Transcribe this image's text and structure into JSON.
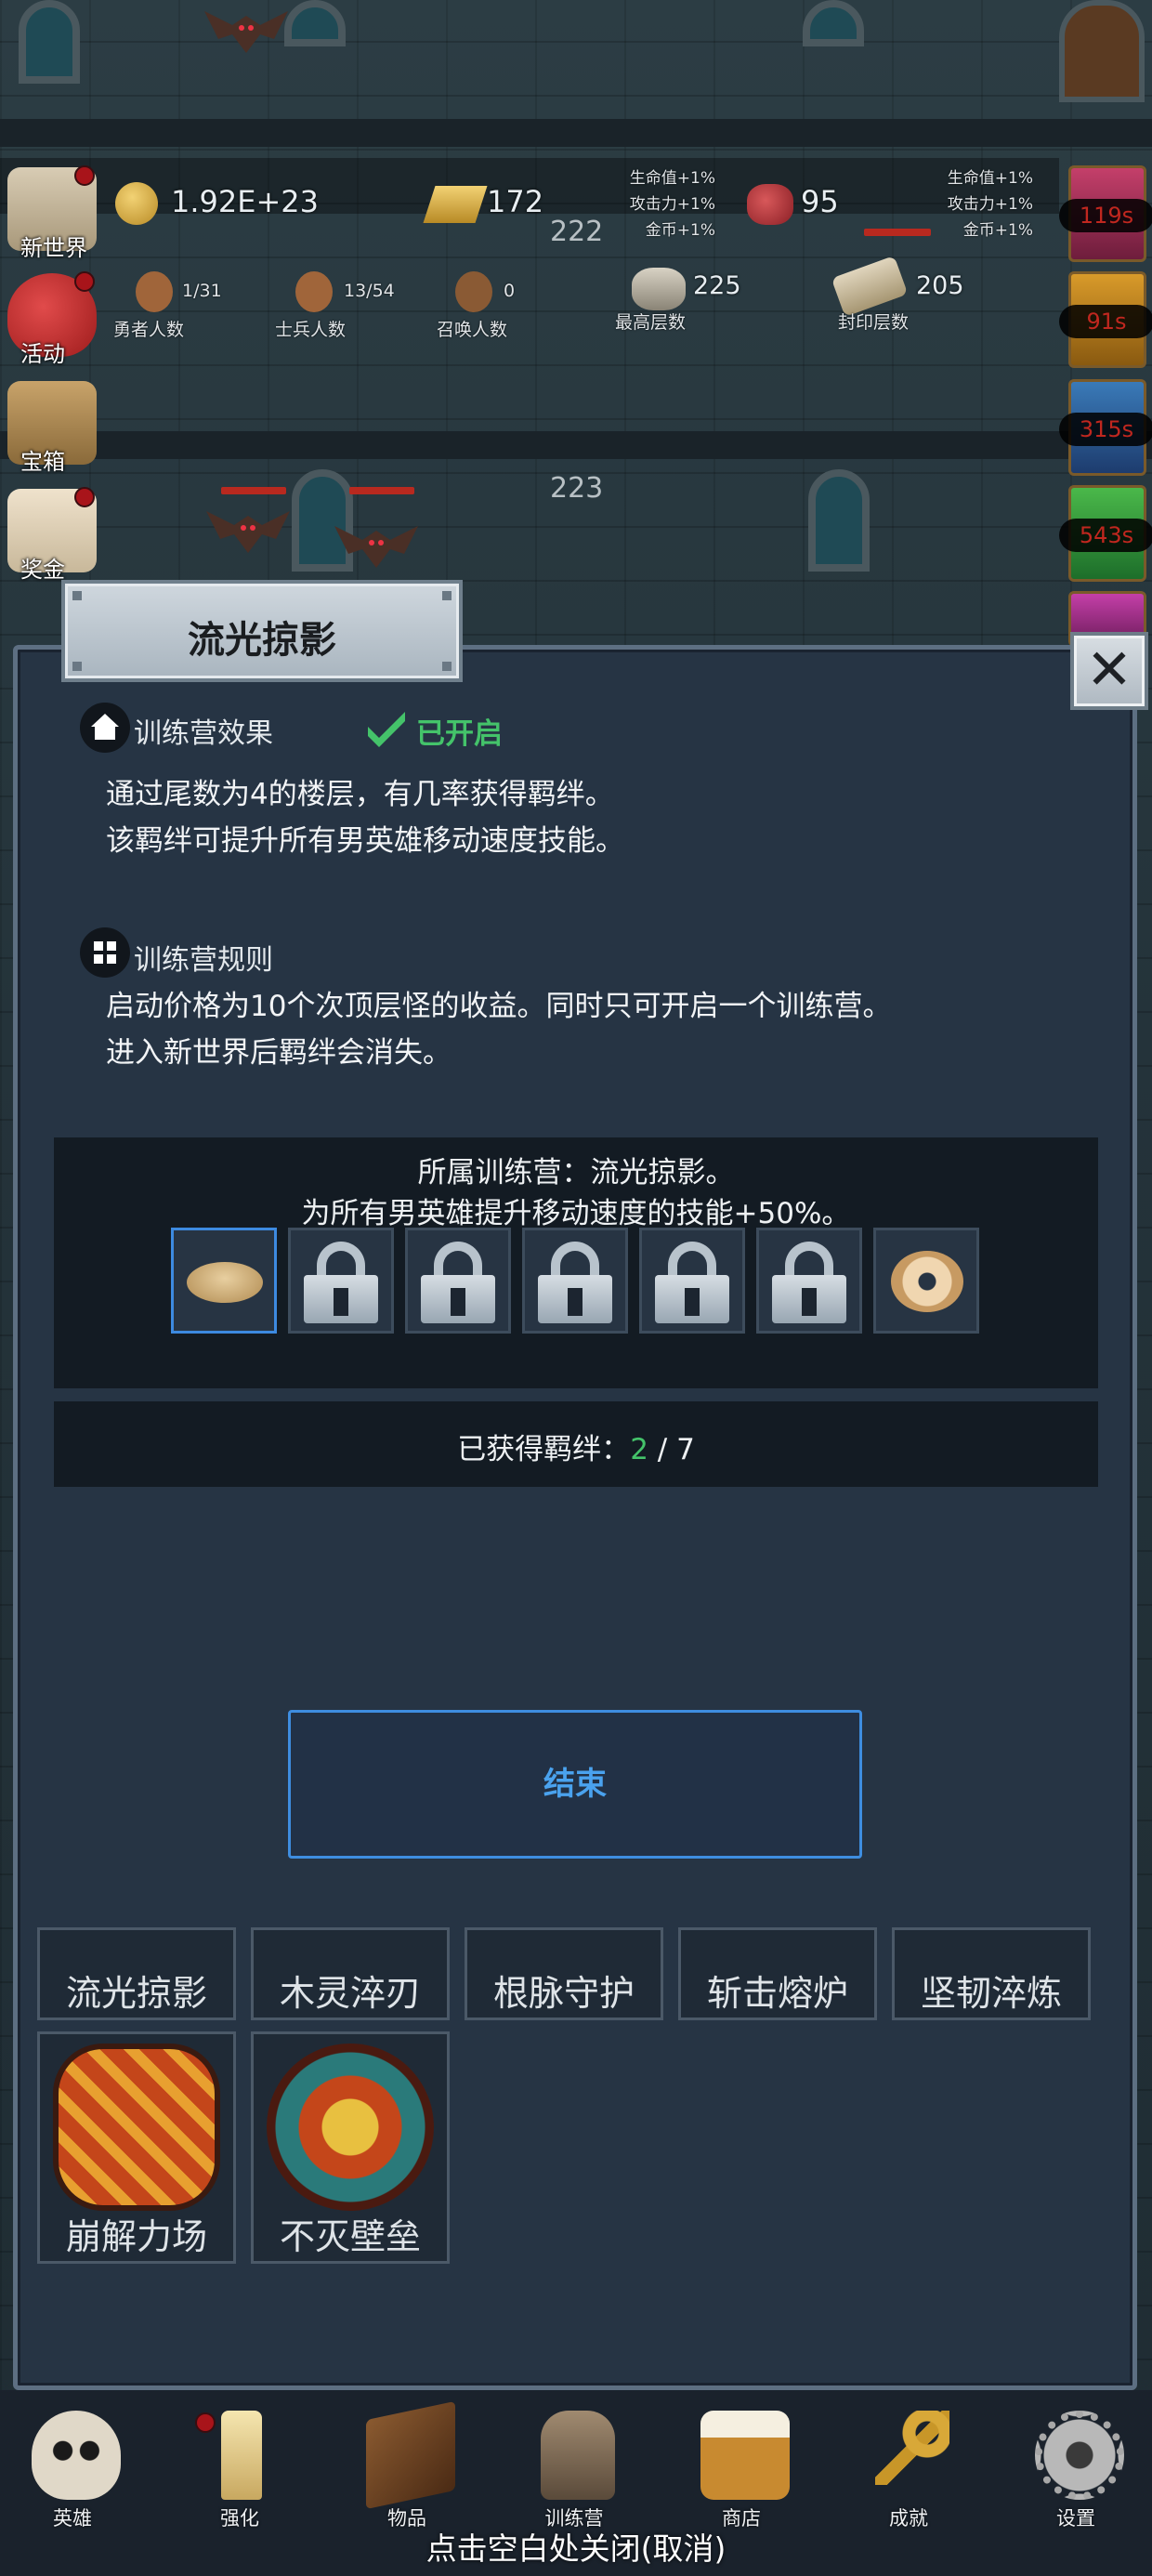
{
  "hud": {
    "side_buttons": [
      {
        "label": "新世界",
        "icon": "castle-scroll-icon",
        "badge": true
      },
      {
        "label": "活动",
        "icon": "heart-icon",
        "badge": true
      },
      {
        "label": "宝箱",
        "icon": "treasure-chest-icon",
        "badge": false
      },
      {
        "label": "奖金",
        "icon": "envelope-icon",
        "badge": true
      }
    ],
    "gold": "1.92E+23",
    "gold_bars": "172",
    "meat": "95",
    "buffs_a": [
      "生命值+1%",
      "攻击力+1%",
      "金币+1%"
    ],
    "buffs_b": [
      "生命值+1%",
      "攻击力+1%",
      "金币+1%"
    ],
    "floor_top": "222",
    "floor_mid": "223",
    "heroes": {
      "value": "1/31",
      "label": "勇者人数"
    },
    "soldiers": {
      "value": "13/54",
      "label": "士兵人数"
    },
    "summons": {
      "value": "0",
      "label": "召唤人数"
    },
    "max_floor": {
      "value": "225",
      "label": "最高层数"
    },
    "sealed_floor": {
      "value": "205",
      "label": "封印层数"
    },
    "timers": [
      "119s",
      "91s",
      "315s",
      "543s"
    ]
  },
  "dialog": {
    "tab_title": "流光掠影",
    "close_icon": "close-x-icon",
    "effect_title": "训练营效果",
    "status": "已开启",
    "effect_lines": [
      "通过尾数为4的楼层，有几率获得羁绊。",
      "该羁绊可提升所有男英雄移动速度技能。"
    ],
    "rules_title": "训练营规则",
    "rules_lines": [
      "启动价格为10个次顶层怪的收益。同时只可开启一个训练营。",
      "进入新世界后羁绊会消失。"
    ],
    "camp_line1": "所属训练营：流光掠影。",
    "camp_line2": "为所有男英雄提升移动速度的技能+50%。",
    "bond_slots": [
      "fish-bread-icon",
      "lock-icon",
      "lock-icon",
      "lock-icon",
      "lock-icon",
      "lock-icon",
      "donut-icon"
    ],
    "obtained_label": "已获得羁绊：",
    "obtained_count": "2",
    "obtained_total": "/ 7",
    "end_button": "结束"
  },
  "camps": [
    "流光掠影",
    "木灵淬刃",
    "根脉守护",
    "斩击熔炉",
    "坚韧淬炼",
    "崩解力场",
    "不灭壁垒"
  ],
  "nav": [
    {
      "label": "英雄",
      "icon": "skull-icon"
    },
    {
      "label": "强化",
      "icon": "candle-icon"
    },
    {
      "label": "物品",
      "icon": "book-icon"
    },
    {
      "label": "训练营",
      "icon": "lantern-icon"
    },
    {
      "label": "商店",
      "icon": "beer-mug-icon"
    },
    {
      "label": "成就",
      "icon": "key-icon"
    },
    {
      "label": "设置",
      "icon": "gear-icon"
    }
  ],
  "footer_hint": "点击空白处关闭(取消)"
}
